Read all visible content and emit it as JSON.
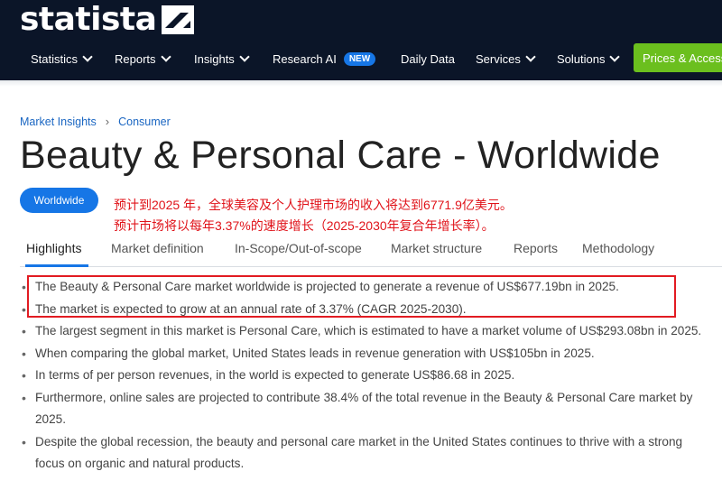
{
  "header": {
    "logo_text": "statista",
    "nav": [
      {
        "label": "Statistics",
        "dropdown": true
      },
      {
        "label": "Reports",
        "dropdown": true
      },
      {
        "label": "Insights",
        "dropdown": true
      },
      {
        "label": "Research AI",
        "badge": "NEW"
      },
      {
        "label": "Daily Data"
      },
      {
        "label": "Services",
        "dropdown": true
      },
      {
        "label": "Solutions",
        "dropdown": true
      }
    ],
    "cta_label": "Prices & Access"
  },
  "breadcrumb": [
    "Market Insights",
    "Consumer"
  ],
  "page_title": "Beauty & Personal Care - Worldwide",
  "region_pill": "Worldwide",
  "annotation": {
    "line1": "预计到2025 年，全球美容及个人护理市场的收入将达到6771.9亿美元。",
    "line2": "预计市场将以每年3.37%的速度增长（2025-2030年复合年增长率）。"
  },
  "tabs": [
    "Highlights",
    "Market definition",
    "In-Scope/Out-of-scope",
    "Market structure",
    "Reports",
    "Methodology"
  ],
  "highlights": [
    "The Beauty & Personal Care market worldwide is projected to generate a revenue of US$677.19bn in 2025.",
    "The market is expected to grow at an annual rate of 3.37% (CAGR 2025-2030).",
    "The largest segment in this market is Personal Care, which is estimated to have a market volume of US$293.08bn in 2025.",
    "When comparing the global market, United States leads in revenue generation with US$105bn in 2025.",
    "In terms of per person revenues, in the world is expected to generate US$86.68 in 2025.",
    "Furthermore, online sales are projected to contribute 38.4% of the total revenue in the Beauty & Personal Care market by 2025.",
    "Despite the global recession, the beauty and personal care market in the United States continues to thrive with a strong focus on organic and natural products."
  ],
  "colors": {
    "header_bg": "#0b1528",
    "accent_blue": "#1676e6",
    "cta_green": "#6bbf1e",
    "annotation_red": "#e0131a"
  }
}
